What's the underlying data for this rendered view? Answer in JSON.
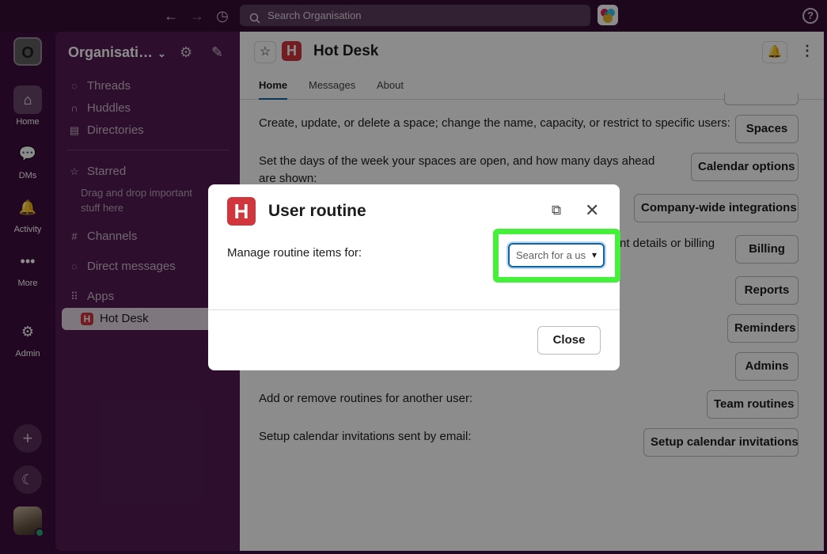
{
  "topbar": {
    "search_placeholder": "Search Organisation",
    "back_icon": "arrow-left",
    "forward_icon": "arrow-right",
    "history_icon": "clock",
    "help_icon": "question-circle"
  },
  "rail": {
    "workspace_initial": "O",
    "items": [
      {
        "label": "Home",
        "icon": "home"
      },
      {
        "label": "DMs",
        "icon": "chat-bubbles"
      },
      {
        "label": "Activity",
        "icon": "bell"
      },
      {
        "label": "More",
        "icon": "ellipsis"
      },
      {
        "label": "Admin",
        "icon": "gear"
      }
    ]
  },
  "sidebar": {
    "org_name": "Organisati…",
    "items": [
      {
        "label": "Threads"
      },
      {
        "label": "Huddles"
      },
      {
        "label": "Directories"
      }
    ],
    "starred_label": "Starred",
    "starred_note": "Drag and drop important stuff here",
    "channels_label": "Channels",
    "dms_label": "Direct messages",
    "apps_label": "Apps",
    "active_app": "Hot Desk"
  },
  "main": {
    "title": "Hot Desk",
    "logo_letter": "H",
    "tabs": [
      "Home",
      "Messages",
      "About"
    ],
    "rows": [
      {
        "text": "Create, update, or delete a space; change the name, capacity, or restrict to specific users:",
        "button": "Spaces"
      },
      {
        "text": "Set the days of the week your spaces are open, and how many days ahead are shown:",
        "button": "Calendar options"
      },
      {
        "text": "",
        "button": "Company-wide integrations"
      },
      {
        "text": "nt details or billing",
        "button": "Billing"
      },
      {
        "text": "",
        "button": "Reports"
      },
      {
        "text": "",
        "button": "Reminders"
      },
      {
        "text": "",
        "button": "Admins"
      },
      {
        "text": "Add or remove routines for another user:",
        "button": "Team routines"
      },
      {
        "text": "Setup calendar invitations sent by email:",
        "button": "Setup calendar invitations"
      }
    ]
  },
  "modal": {
    "title": "User routine",
    "logo_letter": "H",
    "label": "Manage routine items for:",
    "select_placeholder": "Search for a us",
    "close_button": "Close",
    "highlight_color": "#44f03a"
  },
  "colors": {
    "brand_red": "#d0363c",
    "sidebar_bg": "#521d53",
    "rail_bg": "#3f0e40",
    "focus_blue": "#1264a3"
  }
}
